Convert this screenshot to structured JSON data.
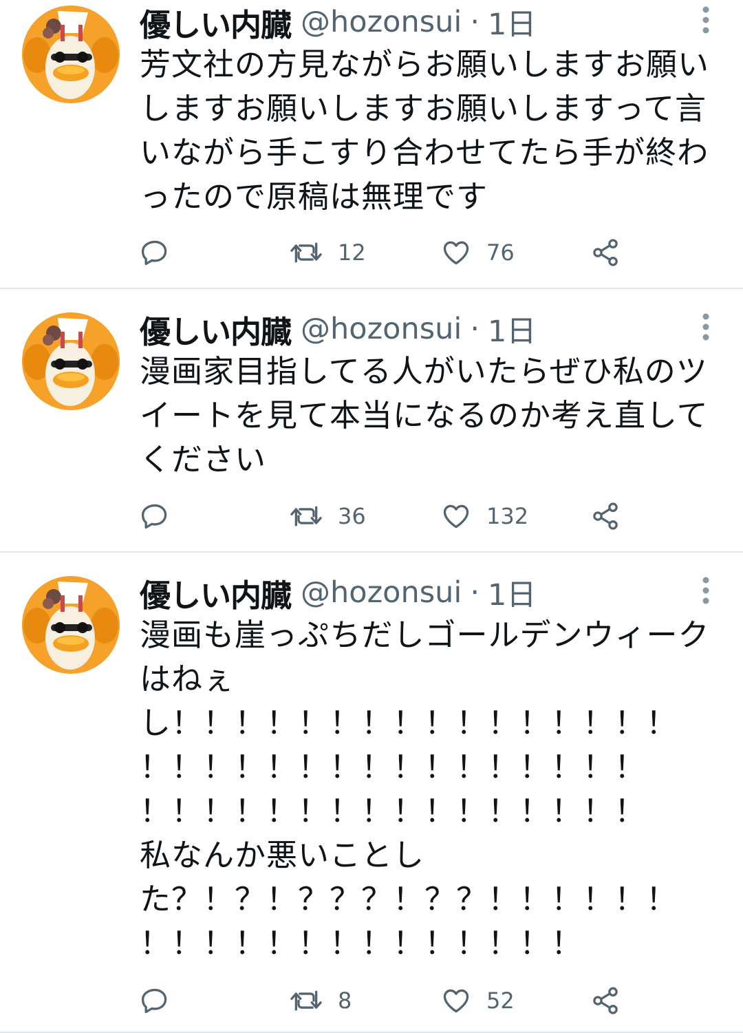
{
  "tweets": [
    {
      "author": {
        "name": "優しい内臓",
        "handle": "@hozonsui"
      },
      "separator": "·",
      "time": "1日",
      "text": "芳文社の方見ながらお願いしますお願いしますお願いしますお願いしますって言いながら手こすり合わせてたら手が終わったので原稿は無理です",
      "stats": {
        "retweets": "12",
        "likes": "76"
      }
    },
    {
      "author": {
        "name": "優しい内臓",
        "handle": "@hozonsui"
      },
      "separator": "·",
      "time": "1日",
      "text": "漫画家目指してる人がいたらぜひ私のツイートを見て本当になるのか考え直してください",
      "stats": {
        "retweets": "36",
        "likes": "132"
      }
    },
    {
      "author": {
        "name": "優しい内臓",
        "handle": "@hozonsui"
      },
      "separator": "·",
      "time": "1日",
      "text": "漫画も崖っぷちだしゴールデンウィークはねぇ\nし！！！！！！！！！！！！！！！！\n！！！！！！！！！！！！！！！！\n！！！！！！！！！！！！！！！！\n私なんか悪いことし\nた？！？！？？？！？？！！！！！！\n！！！！！！！！！！！！！！",
      "stats": {
        "retweets": "8",
        "likes": "52"
      }
    }
  ],
  "icons": {
    "avatar": "avatar-image",
    "more": "more-vertical-icon",
    "reply": "reply-icon",
    "retweet": "retweet-icon",
    "like": "heart-icon",
    "share": "share-icon"
  },
  "colors": {
    "text": "#0f1419",
    "secondary": "#536471",
    "divider": "#e1e8ed",
    "avatar_bg": "#f09a1e"
  }
}
